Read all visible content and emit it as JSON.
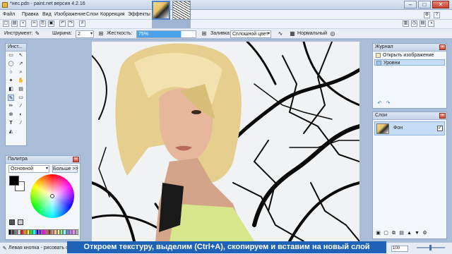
{
  "window": {
    "title": "*нес.pdn - paint.net версия 4.2.16",
    "minimize": "–",
    "maximize": "□",
    "close": "✕"
  },
  "menu": {
    "items": [
      "Файл",
      "Правка",
      "Вид",
      "Изображение",
      "Слои",
      "Коррекция",
      "Эффекты"
    ],
    "icons": [
      "settings-icon",
      "help-icon"
    ]
  },
  "toolbar": {
    "tool_label": "Инструмент:",
    "width_label": "Ширина:",
    "width_value": "2",
    "hardness_label": "Жесткость:",
    "hardness_value": "75%",
    "hardness_percent": 75,
    "fill_label": "Заливка:",
    "fill_value": "Сплошной цвет",
    "blend_value": "Нормальный"
  },
  "tools_panel": {
    "title": "Инст..."
  },
  "palette_panel": {
    "title": "Палитра",
    "mode_value": "Основной",
    "more_button": "Больше >>",
    "primary_color": "#000000",
    "secondary_color": "#ffffff",
    "swatches": [
      "#000000",
      "#404040",
      "#808080",
      "#ffffff",
      "#ff0000",
      "#ff8000",
      "#ffff00",
      "#00ff00",
      "#00ffff",
      "#0000ff",
      "#8000ff",
      "#ff00ff",
      "#ff4080",
      "#804000",
      "#ff8080",
      "#ffc080",
      "#ffff80",
      "#80ff80",
      "#80ffff",
      "#8080ff",
      "#c080ff",
      "#ff80ff",
      "#c0c0c0"
    ]
  },
  "history_panel": {
    "title": "Журнал",
    "items": [
      "Открыть изображение",
      "Уровни"
    ]
  },
  "layers_panel": {
    "title": "Слои",
    "layers": [
      {
        "name": "Фон",
        "visible": true
      }
    ]
  },
  "status": {
    "text": "Левая кнопка - рисовать осно",
    "zoom": "100"
  },
  "subtitle": "Откроем текстуру, выделим (Ctrl+A), скопируем и вставим на новый слой"
}
